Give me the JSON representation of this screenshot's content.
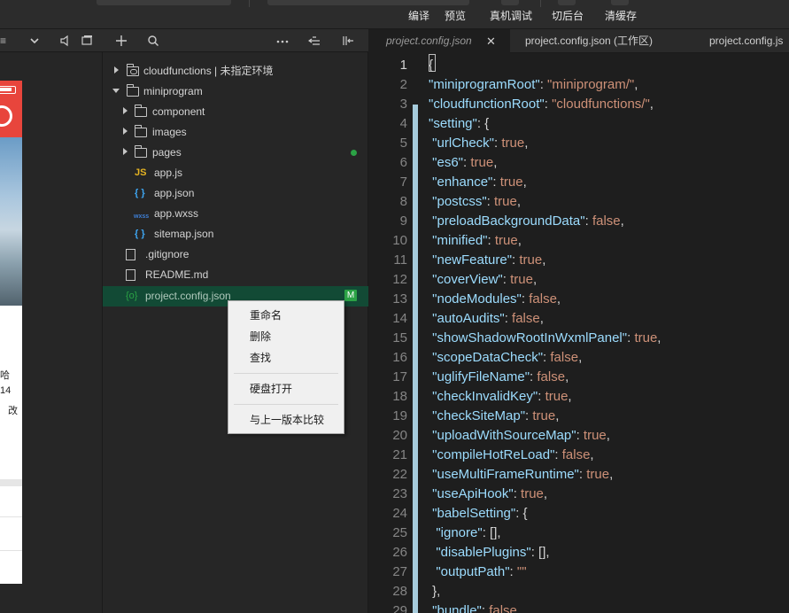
{
  "toolbar": {
    "buttons": [
      "编译",
      "预览",
      "真机调试",
      "切后台",
      "清缓存"
    ]
  },
  "file_tree": {
    "items": [
      {
        "label": "cloudfunctions | 未指定环境",
        "kind": "cloud-folder",
        "chevron": "right"
      },
      {
        "label": "miniprogram",
        "kind": "folder",
        "chevron": "down"
      },
      {
        "label": "component",
        "kind": "folder",
        "chevron": "right"
      },
      {
        "label": "images",
        "kind": "folder",
        "chevron": "right"
      },
      {
        "label": "pages",
        "kind": "folder",
        "chevron": "right"
      },
      {
        "label": "app.js",
        "kind": "js",
        "glyph": "JS"
      },
      {
        "label": "app.json",
        "kind": "json",
        "glyph": "{ }"
      },
      {
        "label": "app.wxss",
        "kind": "wxss",
        "glyph": "wxss"
      },
      {
        "label": "sitemap.json",
        "kind": "json",
        "glyph": "{ }"
      },
      {
        "label": ".gitignore",
        "kind": "file"
      },
      {
        "label": "README.md",
        "kind": "file"
      },
      {
        "label": "project.config.json",
        "kind": "config",
        "glyph": "{o}",
        "badge": "M"
      }
    ]
  },
  "context_menu": {
    "items": [
      "重命名",
      "删除",
      "查找",
      "硬盘打开",
      "与上一版本比较"
    ]
  },
  "editor": {
    "tabs": [
      {
        "label": "project.config.json",
        "close": "✕"
      },
      {
        "label": "project.config.json (工作区)"
      },
      {
        "label": "project.config.js"
      }
    ],
    "line_numbers": [
      "1",
      "2",
      "3",
      "4",
      "5",
      "6",
      "7",
      "8",
      "9",
      "10",
      "11",
      "12",
      "13",
      "14",
      "15",
      "16",
      "17",
      "18",
      "19",
      "20",
      "21",
      "22",
      "23",
      "24",
      "25",
      "26",
      "27",
      "28",
      "29"
    ],
    "lines": [
      [
        {
          "t": "p",
          "v": "{"
        }
      ],
      [
        {
          "t": "k",
          "v": "\"miniprogramRoot\""
        },
        {
          "t": "p",
          "v": ": "
        },
        {
          "t": "s",
          "v": "\"miniprogram/\""
        },
        {
          "t": "p",
          "v": ","
        }
      ],
      [
        {
          "t": "k",
          "v": "\"cloudfunctionRoot\""
        },
        {
          "t": "p",
          "v": ": "
        },
        {
          "t": "s",
          "v": "\"cloudfunctions/\""
        },
        {
          "t": "p",
          "v": ","
        }
      ],
      [
        {
          "t": "k",
          "v": "\"setting\""
        },
        {
          "t": "p",
          "v": ": {"
        }
      ],
      [
        {
          "t": "k",
          "v": " \"urlCheck\""
        },
        {
          "t": "p",
          "v": ": "
        },
        {
          "t": "s",
          "v": "true"
        },
        {
          "t": "p",
          "v": ","
        }
      ],
      [
        {
          "t": "k",
          "v": " \"es6\""
        },
        {
          "t": "p",
          "v": ": "
        },
        {
          "t": "s",
          "v": "true"
        },
        {
          "t": "p",
          "v": ","
        }
      ],
      [
        {
          "t": "k",
          "v": " \"enhance\""
        },
        {
          "t": "p",
          "v": ": "
        },
        {
          "t": "s",
          "v": "true"
        },
        {
          "t": "p",
          "v": ","
        }
      ],
      [
        {
          "t": "k",
          "v": " \"postcss\""
        },
        {
          "t": "p",
          "v": ": "
        },
        {
          "t": "s",
          "v": "true"
        },
        {
          "t": "p",
          "v": ","
        }
      ],
      [
        {
          "t": "k",
          "v": " \"preloadBackgroundData\""
        },
        {
          "t": "p",
          "v": ": "
        },
        {
          "t": "s",
          "v": "false"
        },
        {
          "t": "p",
          "v": ","
        }
      ],
      [
        {
          "t": "k",
          "v": " \"minified\""
        },
        {
          "t": "p",
          "v": ": "
        },
        {
          "t": "s",
          "v": "true"
        },
        {
          "t": "p",
          "v": ","
        }
      ],
      [
        {
          "t": "k",
          "v": " \"newFeature\""
        },
        {
          "t": "p",
          "v": ": "
        },
        {
          "t": "s",
          "v": "true"
        },
        {
          "t": "p",
          "v": ","
        }
      ],
      [
        {
          "t": "k",
          "v": " \"coverView\""
        },
        {
          "t": "p",
          "v": ": "
        },
        {
          "t": "s",
          "v": "true"
        },
        {
          "t": "p",
          "v": ","
        }
      ],
      [
        {
          "t": "k",
          "v": " \"nodeModules\""
        },
        {
          "t": "p",
          "v": ": "
        },
        {
          "t": "s",
          "v": "false"
        },
        {
          "t": "p",
          "v": ","
        }
      ],
      [
        {
          "t": "k",
          "v": " \"autoAudits\""
        },
        {
          "t": "p",
          "v": ": "
        },
        {
          "t": "s",
          "v": "false"
        },
        {
          "t": "p",
          "v": ","
        }
      ],
      [
        {
          "t": "k",
          "v": " \"showShadowRootInWxmlPanel\""
        },
        {
          "t": "p",
          "v": ": "
        },
        {
          "t": "s",
          "v": "true"
        },
        {
          "t": "p",
          "v": ","
        }
      ],
      [
        {
          "t": "k",
          "v": " \"scopeDataCheck\""
        },
        {
          "t": "p",
          "v": ": "
        },
        {
          "t": "s",
          "v": "false"
        },
        {
          "t": "p",
          "v": ","
        }
      ],
      [
        {
          "t": "k",
          "v": " \"uglifyFileName\""
        },
        {
          "t": "p",
          "v": ": "
        },
        {
          "t": "s",
          "v": "false"
        },
        {
          "t": "p",
          "v": ","
        }
      ],
      [
        {
          "t": "k",
          "v": " \"checkInvalidKey\""
        },
        {
          "t": "p",
          "v": ": "
        },
        {
          "t": "s",
          "v": "true"
        },
        {
          "t": "p",
          "v": ","
        }
      ],
      [
        {
          "t": "k",
          "v": " \"checkSiteMap\""
        },
        {
          "t": "p",
          "v": ": "
        },
        {
          "t": "s",
          "v": "true"
        },
        {
          "t": "p",
          "v": ","
        }
      ],
      [
        {
          "t": "k",
          "v": " \"uploadWithSourceMap\""
        },
        {
          "t": "p",
          "v": ": "
        },
        {
          "t": "s",
          "v": "true"
        },
        {
          "t": "p",
          "v": ","
        }
      ],
      [
        {
          "t": "k",
          "v": " \"compileHotReLoad\""
        },
        {
          "t": "p",
          "v": ": "
        },
        {
          "t": "s",
          "v": "false"
        },
        {
          "t": "p",
          "v": ","
        }
      ],
      [
        {
          "t": "k",
          "v": " \"useMultiFrameRuntime\""
        },
        {
          "t": "p",
          "v": ": "
        },
        {
          "t": "s",
          "v": "true"
        },
        {
          "t": "p",
          "v": ","
        }
      ],
      [
        {
          "t": "k",
          "v": " \"useApiHook\""
        },
        {
          "t": "p",
          "v": ": "
        },
        {
          "t": "s",
          "v": "true"
        },
        {
          "t": "p",
          "v": ","
        }
      ],
      [
        {
          "t": "k",
          "v": " \"babelSetting\""
        },
        {
          "t": "p",
          "v": ": {"
        }
      ],
      [
        {
          "t": "k",
          "v": "  \"ignore\""
        },
        {
          "t": "p",
          "v": ": [],"
        }
      ],
      [
        {
          "t": "k",
          "v": "  \"disablePlugins\""
        },
        {
          "t": "p",
          "v": ": [],"
        }
      ],
      [
        {
          "t": "k",
          "v": "  \"outputPath\""
        },
        {
          "t": "p",
          "v": ": "
        },
        {
          "t": "s",
          "v": "\"\""
        }
      ],
      [
        {
          "t": "p",
          "v": " },"
        }
      ],
      [
        {
          "t": "k",
          "v": " \"bundle\""
        },
        {
          "t": "p",
          "v": ": "
        },
        {
          "t": "s",
          "v": "false"
        },
        {
          "t": "p",
          "v": ","
        }
      ]
    ]
  },
  "simulator": {
    "text_fragments": [
      "哈",
      "14",
      "改"
    ]
  },
  "colors": {
    "key": "#9cdcfe",
    "string": "#ce9178",
    "selected_row": "#124a35",
    "git_green": "#2ba245",
    "brand_red": "#e8453c"
  }
}
